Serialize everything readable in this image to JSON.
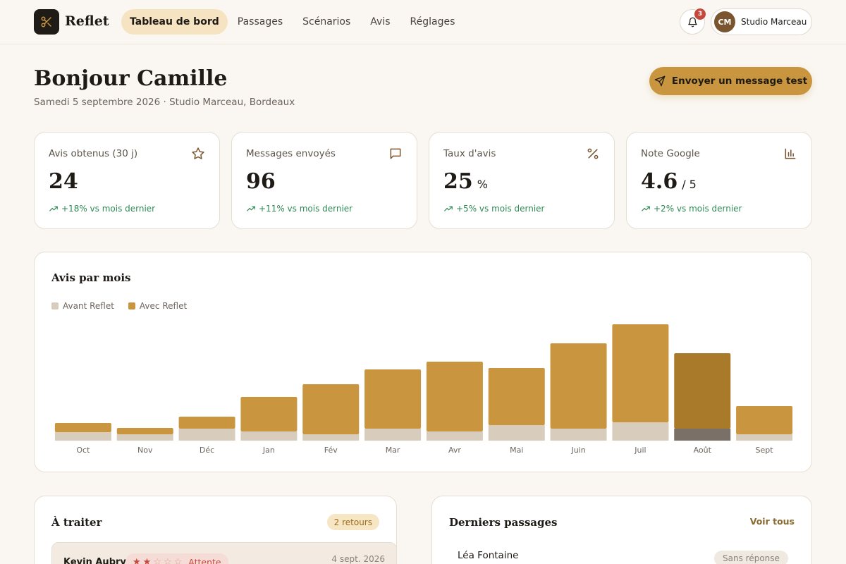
{
  "nav": {
    "brand": "Reflet",
    "links": [
      {
        "label": "Tableau de bord",
        "active": true
      },
      {
        "label": "Passages",
        "active": false
      },
      {
        "label": "Scénarios",
        "active": false
      },
      {
        "label": "Avis",
        "active": false
      },
      {
        "label": "Réglages",
        "active": false
      }
    ],
    "notifications_count": "3",
    "account": {
      "initials": "CM",
      "name": "Studio Marceau"
    }
  },
  "header": {
    "greeting": "Bonjour Camille",
    "subline": "Samedi 5 septembre 2026 · Studio Marceau, Bordeaux",
    "cta_label": "Envoyer un message test"
  },
  "kpis": [
    {
      "label": "Avis obtenus (30 j)",
      "value": "24",
      "unit": "",
      "trend": "+18% vs mois dernier",
      "icon": "star-icon"
    },
    {
      "label": "Messages envoyés",
      "value": "96",
      "unit": "",
      "trend": "+11% vs mois dernier",
      "icon": "message-icon"
    },
    {
      "label": "Taux d'avis",
      "value": "25",
      "unit": "%",
      "trend": "+5% vs mois dernier",
      "icon": "percent-icon"
    },
    {
      "label": "Note Google",
      "value": "4.6",
      "unit": "/ 5",
      "trend": "+2% vs mois dernier",
      "icon": "bar-chart-icon"
    }
  ],
  "colors": {
    "accent": "#c9963f",
    "accent_dark": "#a87a2a",
    "before": "#d8cdbd",
    "before_dark": "#7a7068",
    "trend_green": "#2f8a55",
    "danger": "#c8473b"
  },
  "chart_data": {
    "type": "bar",
    "stacked": true,
    "title": "Avis par mois",
    "categories": [
      "Oct",
      "Nov",
      "Déc",
      "Jan",
      "Fév",
      "Mar",
      "Avr",
      "Mai",
      "Juin",
      "Juil",
      "Août",
      "Sept"
    ],
    "series": [
      {
        "name": "Avant Reflet",
        "values": [
          12,
          9,
          17,
          13,
          9,
          17,
          13,
          22,
          17,
          26,
          17,
          9
        ]
      },
      {
        "name": "Avec Reflet",
        "values": [
          13,
          9,
          17,
          49,
          71,
          84,
          99,
          81,
          121,
          139,
          107,
          40
        ]
      }
    ],
    "highlight_index": 10,
    "legend_position": "top-left",
    "grid": false
  },
  "todo": {
    "title": "À traiter",
    "badge": "2 retours",
    "items": [
      {
        "name": "Kevin Aubry",
        "rating": 2,
        "max": 5,
        "status": "Attente",
        "date": "4 sept. 2026"
      }
    ]
  },
  "recent": {
    "title": "Derniers passages",
    "link": "Voir tous",
    "items": [
      {
        "name": "Léa Fontaine",
        "status": "Sans réponse"
      }
    ]
  }
}
